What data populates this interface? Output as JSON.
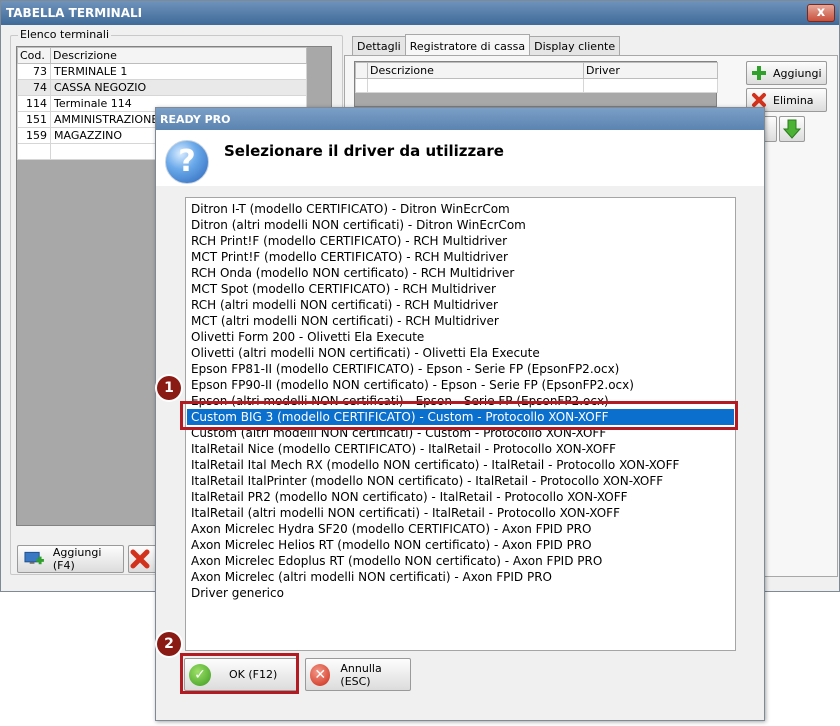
{
  "main_window": {
    "title": "TABELLA TERMINALI",
    "close_label": "x",
    "group_label": "Elenco terminali",
    "terminals_table": {
      "headers": [
        "Cod.",
        "Descrizione"
      ],
      "rows": [
        {
          "code": "73",
          "desc": "TERMINALE 1"
        },
        {
          "code": "74",
          "desc": "CASSA NEGOZIO"
        },
        {
          "code": "114",
          "desc": "Terminale 114"
        },
        {
          "code": "151",
          "desc": "AMMINISTRAZIONE"
        },
        {
          "code": "159",
          "desc": "MAGAZZINO"
        }
      ]
    },
    "add_button_label": "Aggiungi (F4)",
    "tabs": [
      "Dettagli",
      "Registratore di cassa",
      "Display cliente"
    ],
    "active_tab": "Registratore di cassa",
    "driver_table_headers": [
      "Descrizione",
      "Driver"
    ],
    "aggiungi_label": "Aggiungi",
    "elimina_label": "Elimina"
  },
  "dialog": {
    "title": "READY PRO",
    "heading": "Selezionare il driver da utilizzare",
    "drivers": [
      "Ditron I-T (modello CERTIFICATO) - Ditron WinEcrCom",
      "Ditron (altri modelli NON certificati) - Ditron WinEcrCom",
      "RCH Print!F (modello CERTIFICATO) - RCH Multidriver",
      "MCT Print!F (modello CERTIFICATO) - RCH Multidriver",
      "RCH Onda (modello NON certificato) - RCH Multidriver",
      "MCT Spot (modello CERTIFICATO) - RCH Multidriver",
      "RCH (altri modelli NON certificati) - RCH Multidriver",
      "MCT (altri modelli NON certificati) - RCH Multidriver",
      "Olivetti Form 200 - Olivetti Ela Execute",
      "Olivetti (altri modelli NON certificati) - Olivetti Ela Execute",
      "Epson FP81-II (modello CERTIFICATO) - Epson - Serie FP (EpsonFP2.ocx)",
      "Epson FP90-II (modello NON certificato) - Epson - Serie FP (EpsonFP2.ocx)",
      "Epson (altri modelli NON certificati) - Epson - Serie FP (EpsonFP2.ocx)",
      "Custom BIG 3 (modello CERTIFICATO) - Custom - Protocollo XON-XOFF",
      "Custom (altri modelli NON certificati) - Custom - Protocollo XON-XOFF",
      "ItalRetail Nice (modello CERTIFICATO) - ItalRetail - Protocollo XON-XOFF",
      "ItalRetail Ital Mech RX (modello NON certificato) - ItalRetail - Protocollo XON-XOFF",
      "ItalRetail ItalPrinter (modello NON certificato) - ItalRetail - Protocollo XON-XOFF",
      "ItalRetail PR2 (modello NON certificato) - ItalRetail - Protocollo XON-XOFF",
      "ItalRetail (altri modelli NON certificati) - ItalRetail - Protocollo XON-XOFF",
      "Axon Micrelec Hydra SF20 (modello CERTIFICATO) - Axon FPID PRO",
      "Axon Micrelec Helios RT (modello NON certificato) - Axon FPID PRO",
      "Axon Micrelec Edoplus RT (modello NON certificato) - Axon FPID PRO",
      "Axon Micrelec (altri modelli NON certificati) - Axon FPID PRO",
      "Driver generico"
    ],
    "selected_index": 13,
    "ok_label": "OK (F12)",
    "cancel_label": "Annulla (ESC)"
  },
  "callouts": [
    "1",
    "2"
  ],
  "colors": {
    "selection": "#0a6fcd",
    "callout": "#b21b22",
    "titlebar": "#3f6a99"
  }
}
